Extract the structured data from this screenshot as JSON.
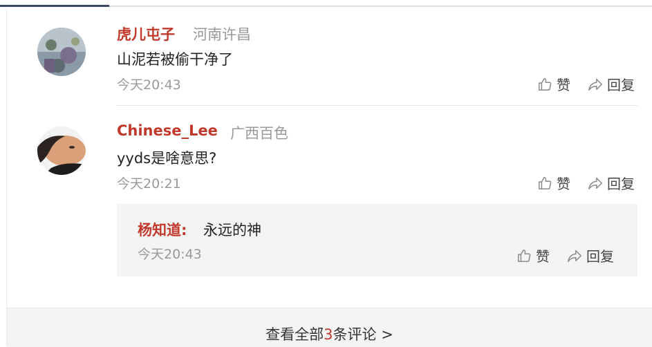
{
  "comments": [
    {
      "name": "虎儿屯子",
      "location": "河南许昌",
      "text": "山泥若被偷干净了",
      "time": "今天20:43",
      "like_label": "赞",
      "reply_label": "回复"
    },
    {
      "name": "Chinese_Lee",
      "location": "广西百色",
      "text": "yyds是啥意思?",
      "time": "今天20:21",
      "like_label": "赞",
      "reply_label": "回复",
      "replies": [
        {
          "name": "杨知道:",
          "text": "永远的神",
          "time": "今天20:43",
          "like_label": "赞",
          "reply_label": "回复"
        }
      ]
    }
  ],
  "footer": {
    "prefix": "查看全部",
    "count": "3",
    "suffix": "条评论 >"
  },
  "colors": {
    "accent": "#c0392b",
    "muted": "#999999"
  },
  "icons": [
    "thumbs-up-icon",
    "reply-arrow-icon"
  ]
}
